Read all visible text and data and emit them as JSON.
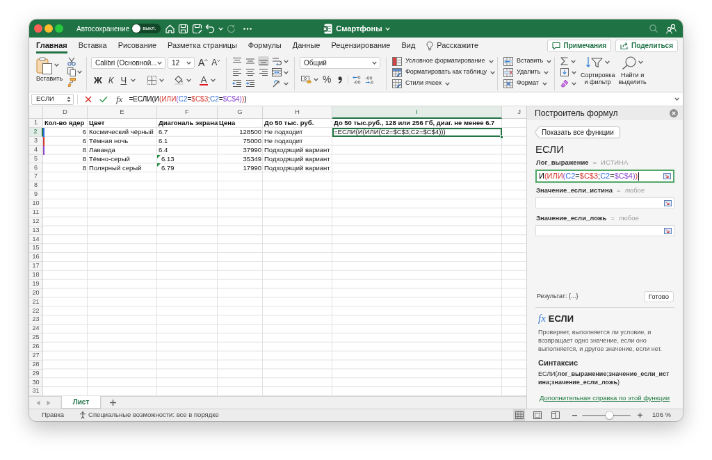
{
  "window": {
    "title": "Смартфоны",
    "autosave": {
      "label": "Автосохранение",
      "on": false,
      "state_text": "выкл."
    }
  },
  "ribbon_tabs": [
    {
      "label": "Главная",
      "selected": true
    },
    {
      "label": "Вставка",
      "selected": false
    },
    {
      "label": "Рисование",
      "selected": false
    },
    {
      "label": "Разметка страницы",
      "selected": false
    },
    {
      "label": "Формулы",
      "selected": false
    },
    {
      "label": "Данные",
      "selected": false
    },
    {
      "label": "Рецензирование",
      "selected": false
    },
    {
      "label": "Вид",
      "selected": false
    }
  ],
  "tell_me": {
    "placeholder": "Расскажите"
  },
  "header_buttons": [
    {
      "label": "Примечания",
      "kind": "comments"
    },
    {
      "label": "Поделиться",
      "kind": "share"
    }
  ],
  "ribbon": {
    "paste": {
      "label": "Вставить"
    },
    "font": {
      "name": "Calibri (Основной...",
      "size": "12",
      "grow": "A",
      "shrink": "A",
      "bold": "Ж",
      "italic": "К",
      "underline": "Ч",
      "ink": "A"
    },
    "alignment": [
      {
        "kind": "top",
        "selected": false
      },
      {
        "kind": "middle",
        "selected": false
      },
      {
        "kind": "bottom",
        "selected": true
      },
      {
        "kind": "wrap",
        "selected": false
      },
      {
        "kind": "left",
        "selected": false
      },
      {
        "kind": "center",
        "selected": false
      },
      {
        "kind": "right",
        "selected": false
      },
      {
        "kind": "merge",
        "selected": false
      },
      {
        "kind": "outdent",
        "selected": false
      },
      {
        "kind": "indent",
        "selected": false
      },
      {
        "kind": "orientation",
        "selected": false
      }
    ],
    "number": {
      "format": "Общий",
      "percent": "%"
    },
    "styles": [
      {
        "kind": "conditional",
        "label": "Условное форматирование"
      },
      {
        "kind": "table",
        "label": "Форматировать как таблицу"
      },
      {
        "kind": "cell_styles",
        "label": "Стили ячеек"
      }
    ],
    "cells": [
      {
        "kind": "insert",
        "label": "Вставить"
      },
      {
        "kind": "delete",
        "label": "Удалить"
      },
      {
        "kind": "format",
        "label": "Формат"
      }
    ],
    "editing": {
      "sort_label": "Сортировка\nи фильтр",
      "find_label": "Найти и\nвыделить"
    }
  },
  "formula_bar": {
    "name_box": "ЕСЛИ",
    "fx": "fx",
    "formula": [
      {
        "text": "=ЕСЛИ(И",
        "kind": "plain"
      },
      {
        "text": "(ИЛИ",
        "kind": "accent2"
      },
      {
        "text": "(",
        "kind": "accent3"
      },
      {
        "text": "C2",
        "kind": "accent1"
      },
      {
        "text": "=",
        "kind": "plain"
      },
      {
        "text": "$C$3",
        "kind": "accent2"
      },
      {
        "text": ";",
        "kind": "plain"
      },
      {
        "text": "C2",
        "kind": "accent1"
      },
      {
        "text": "=",
        "kind": "plain"
      },
      {
        "text": "$C$4",
        "kind": "accent3"
      },
      {
        "text": ")",
        "kind": "accent3"
      },
      {
        "text": ")",
        "kind": "accent2"
      },
      {
        "text": ")",
        "kind": "plain"
      }
    ]
  },
  "sheet": {
    "columns": [
      {
        "name": "D",
        "selected": false
      },
      {
        "name": "E",
        "selected": false
      },
      {
        "name": "F",
        "selected": false
      },
      {
        "name": "G",
        "selected": false
      },
      {
        "name": "H",
        "selected": false
      },
      {
        "name": "I",
        "selected": true
      },
      {
        "name": "J",
        "selected": false
      }
    ],
    "rows": [
      {
        "number": "1",
        "selected": false,
        "cells": [
          {
            "text": "Кол-во ядер",
            "kind": "heading",
            "warning": false
          },
          {
            "text": "Цвет",
            "kind": "heading",
            "warning": false
          },
          {
            "text": "Диагональ экрана",
            "kind": "heading",
            "warning": false
          },
          {
            "text": "Цена",
            "kind": "heading",
            "warning": false
          },
          {
            "text": "До 50 тыс. руб.",
            "kind": "heading",
            "warning": false
          },
          {
            "text": "До 50 тыс.руб., 128 или 256 Гб, диаг. не менее 6.7",
            "kind": "heading",
            "warning": false
          }
        ]
      },
      {
        "number": "2",
        "selected": true,
        "color": "#2f6fdc",
        "cells": [
          {
            "text": "6",
            "kind": "number",
            "warning": false
          },
          {
            "text": "Космический чёрный",
            "kind": "text",
            "warning": false
          },
          {
            "text": "6.7",
            "kind": "text",
            "warning": false
          },
          {
            "text": "128500",
            "kind": "number",
            "warning": false
          },
          {
            "text": "Не подходит",
            "kind": "text",
            "warning": false
          },
          {
            "text": "=ЕСЛИ(И(ИЛИ(C2=$C$3;C2=$C$4)))",
            "kind": "text",
            "warning": false
          }
        ]
      },
      {
        "number": "3",
        "selected": false,
        "color": "#d6372f",
        "cells": [
          {
            "text": "6",
            "kind": "number",
            "warning": false
          },
          {
            "text": "Тёмная ночь",
            "kind": "text",
            "warning": false
          },
          {
            "text": "6.1",
            "kind": "text",
            "warning": false
          },
          {
            "text": "75000",
            "kind": "number",
            "warning": false
          },
          {
            "text": "Не подходит",
            "kind": "text",
            "warning": false
          }
        ]
      },
      {
        "number": "4",
        "selected": false,
        "color": "#8a4bd0",
        "cells": [
          {
            "text": "8",
            "kind": "number",
            "warning": false
          },
          {
            "text": "Лаванда",
            "kind": "text",
            "warning": false
          },
          {
            "text": "6.4",
            "kind": "text",
            "warning": false
          },
          {
            "text": "37990",
            "kind": "number",
            "warning": false
          },
          {
            "text": "Подходящий вариант",
            "kind": "text",
            "warning": false
          }
        ]
      },
      {
        "number": "5",
        "selected": false,
        "cells": [
          {
            "text": "8",
            "kind": "number",
            "warning": false
          },
          {
            "text": "Тёмно-серый",
            "kind": "text",
            "warning": false
          },
          {
            "text": "6.13",
            "kind": "text",
            "warning": true
          },
          {
            "text": "35349",
            "kind": "number",
            "warning": false
          },
          {
            "text": "Подходящий вариант",
            "kind": "text",
            "warning": false
          }
        ]
      },
      {
        "number": "6",
        "selected": false,
        "cells": [
          {
            "text": "8",
            "kind": "number",
            "warning": false
          },
          {
            "text": "Полярный серый",
            "kind": "text",
            "warning": false
          },
          {
            "text": "6.79",
            "kind": "text",
            "warning": true
          },
          {
            "text": "17990",
            "kind": "number",
            "warning": false
          },
          {
            "text": "Подходящий вариант",
            "kind": "text",
            "warning": false
          }
        ]
      },
      {
        "number": "7",
        "selected": false
      },
      {
        "number": "8",
        "selected": false
      },
      {
        "number": "9",
        "selected": false
      },
      {
        "number": "10",
        "selected": false
      },
      {
        "number": "11",
        "selected": false
      },
      {
        "number": "12",
        "selected": false
      },
      {
        "number": "13",
        "selected": false
      },
      {
        "number": "14",
        "selected": false
      },
      {
        "number": "15",
        "selected": false
      },
      {
        "number": "16",
        "selected": false
      },
      {
        "number": "17",
        "selected": false
      },
      {
        "number": "18",
        "selected": false
      },
      {
        "number": "19",
        "selected": false
      },
      {
        "number": "20",
        "selected": false
      },
      {
        "number": "21",
        "selected": false
      },
      {
        "number": "22",
        "selected": false
      },
      {
        "number": "23",
        "selected": false
      },
      {
        "number": "24",
        "selected": false
      },
      {
        "number": "25",
        "selected": false
      },
      {
        "number": "26",
        "selected": false
      },
      {
        "number": "27",
        "selected": false
      },
      {
        "number": "28",
        "selected": false
      },
      {
        "number": "29",
        "selected": false
      },
      {
        "number": "30",
        "selected": false
      },
      {
        "number": "31",
        "selected": false
      }
    ]
  },
  "sheet_tabs": [
    {
      "label": "Лист",
      "selected": true
    }
  ],
  "formula_builder": {
    "title": "Построитель формул",
    "back_button": "Показать все функции",
    "function": "ЕСЛИ",
    "arguments": [
      {
        "name": "Лог_выражение",
        "sign": "=",
        "result": "ИСТИНА",
        "focused": true,
        "value": [
          {
            "text": "И",
            "kind": "plain"
          },
          {
            "text": "(ИЛИ",
            "kind": "accent2"
          },
          {
            "text": "(",
            "kind": "accent3"
          },
          {
            "text": "C2",
            "kind": "accent1"
          },
          {
            "text": "=",
            "kind": "plain"
          },
          {
            "text": "$C$3",
            "kind": "accent2"
          },
          {
            "text": ";",
            "kind": "plain"
          },
          {
            "text": "C2",
            "kind": "accent1"
          },
          {
            "text": "=",
            "kind": "plain"
          },
          {
            "text": "$C$4",
            "kind": "accent3"
          },
          {
            "text": ")",
            "kind": "accent3"
          },
          {
            "text": ")",
            "kind": "accent2"
          }
        ]
      },
      {
        "name": "Значение_если_истина",
        "sign": "=",
        "result": "любое",
        "focused": false
      },
      {
        "name": "Значение_если_ложь",
        "sign": "=",
        "result": "любое",
        "focused": false
      }
    ],
    "result": "Результат: {...}",
    "done_button": "Готово",
    "help": {
      "symbol": "fx",
      "title": "ЕСЛИ",
      "description": "Проверяет, выполняется ли условие, и возвращает одно значение, если оно выполняется, и другое значение, если нет.",
      "syntax_title": "Синтаксис",
      "syntax": "ЕСЛИ(**лог_выражение;значение_если_истина;значение_если_ложь**)",
      "link": "Дополнительная справка по этой функции"
    }
  },
  "status_bar": {
    "mode": "Правка",
    "accessibility": "Специальные возможности: все в порядке",
    "views": [
      {
        "kind": "normal",
        "selected": true
      },
      {
        "kind": "page_layout",
        "selected": false
      },
      {
        "kind": "page_break",
        "selected": false
      }
    ],
    "zoom": {
      "level": 0.57,
      "label": "106 %"
    }
  }
}
